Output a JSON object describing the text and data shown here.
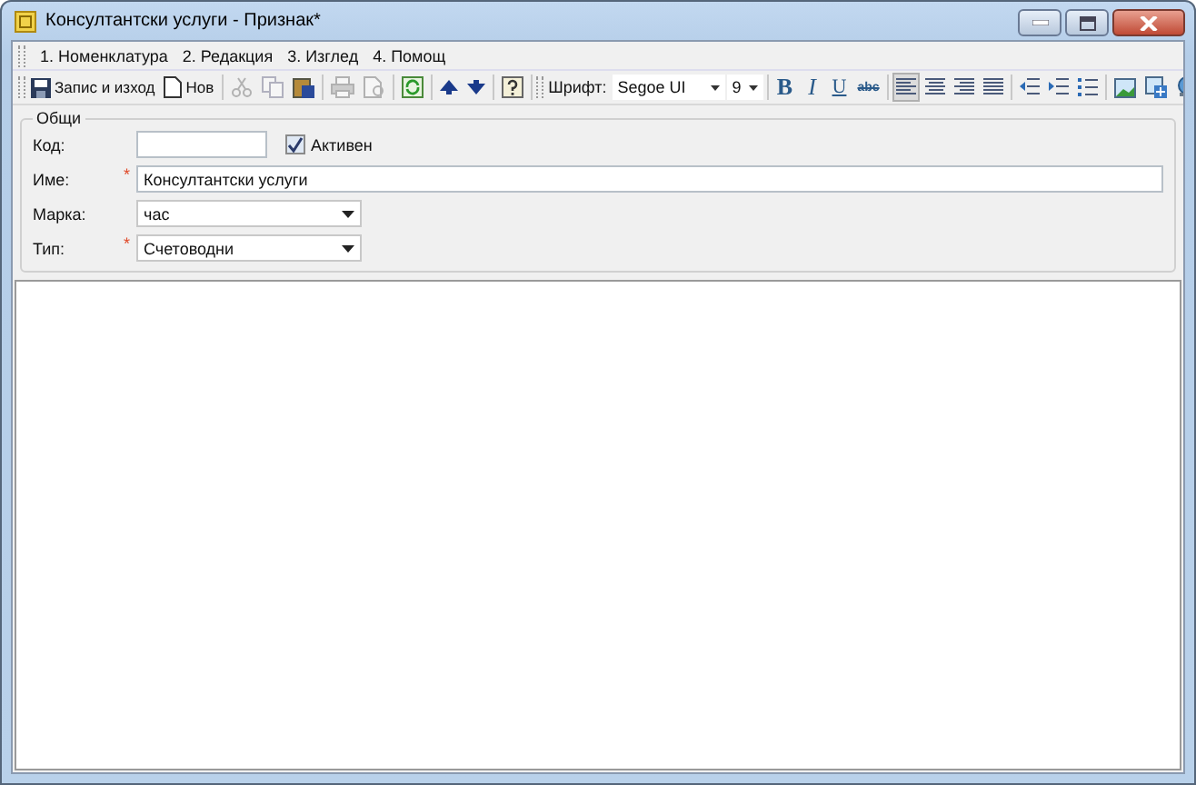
{
  "window": {
    "title": "Консултантски услуги - Признак*"
  },
  "menu": [
    "1. Номенклатура",
    "2. Редакция",
    "3. Изглед",
    "4. Помощ"
  ],
  "toolbar": {
    "save": "Запис и изход",
    "new": "Нов",
    "edit_buttons": [
      {
        "disabled": true
      },
      {
        "disabled": true
      },
      {
        "disabled": false
      }
    ],
    "print_buttons": [
      {
        "disabled": true
      },
      {
        "disabled": true
      }
    ],
    "font_label": "Шрифт:",
    "font": "Segoe UI",
    "size": "9",
    "format_buttons": [
      "B",
      "I",
      "U",
      "abc"
    ],
    "align_buttons": [
      {
        "selected": true
      },
      {
        "selected": false
      },
      {
        "selected": false
      },
      {
        "selected": false
      }
    ]
  },
  "group": {
    "title": "Общи",
    "fields": [
      {
        "kind": "short",
        "label": "Код:"
      },
      {
        "kind": "text",
        "label": "Име:",
        "mark": "*",
        "value": "Консултантски услуги"
      },
      {
        "kind": "select",
        "label": "Марка:",
        "value": "час"
      },
      {
        "kind": "select",
        "label": "Тип:",
        "mark": "*",
        "value": "Счетоводни"
      }
    ],
    "active": {
      "label": "Активен",
      "checked": true
    }
  }
}
